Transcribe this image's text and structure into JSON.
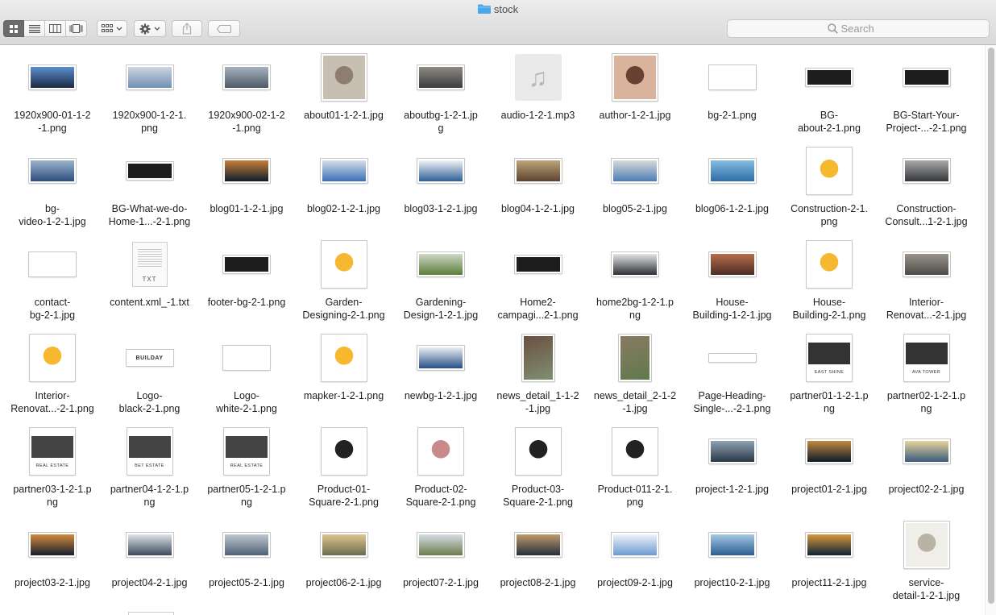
{
  "window": {
    "title": "stock"
  },
  "toolbar": {
    "view_modes": [
      "icon-view",
      "list-view",
      "column-view",
      "cover-flow-view"
    ],
    "search_placeholder": "Search"
  },
  "colors": {
    "toolbar_bg": "#dedede",
    "selected_segment": "#6b6b6b",
    "folder_blue": "#4aa8e8",
    "logo_yellow": "#f5b82e"
  },
  "files": [
    {
      "label": "1920x900-01-1-2\n-1.png",
      "thumb": "wide",
      "colors": [
        "#1b2a44",
        "#5b8fcf"
      ]
    },
    {
      "label": "1920x900-1-2-1.\npng",
      "thumb": "wide",
      "colors": [
        "#6f8fb3",
        "#ccd6df"
      ]
    },
    {
      "label": "1920x900-02-1-2\n-1.png",
      "thumb": "wide",
      "colors": [
        "#4e5967",
        "#a7b2bf"
      ]
    },
    {
      "label": "about01-1-2-1.jpg",
      "thumb": "square",
      "colors": [
        "#c8bfb3",
        "#8d7e70"
      ]
    },
    {
      "label": "aboutbg-1-2-1.jp\ng",
      "thumb": "wide",
      "colors": [
        "#3b3d3f",
        "#8e8a82"
      ]
    },
    {
      "label": "audio-1-2-1.mp3",
      "thumb": "audio"
    },
    {
      "label": "author-1-2-1.jpg",
      "thumb": "square",
      "colors": [
        "#d9b39c",
        "#6a4033"
      ]
    },
    {
      "label": "bg-2-1.png",
      "thumb": "blank"
    },
    {
      "label": "BG-\nabout-2-1.png",
      "thumb": "dark"
    },
    {
      "label": "BG-Start-Your-\nProject-...-2-1.png",
      "thumb": "dark"
    },
    {
      "label": "bg-\nvideo-1-2-1.jpg",
      "thumb": "wide",
      "colors": [
        "#2d4d7c",
        "#9cb3cc"
      ]
    },
    {
      "label": "BG-What-we-do-\nHome-1...-2-1.png",
      "thumb": "dark"
    },
    {
      "label": "blog01-1-2-1.jpg",
      "thumb": "wide",
      "colors": [
        "#0f1c2c",
        "#c77f3a"
      ]
    },
    {
      "label": "blog02-1-2-1.jpg",
      "thumb": "wide",
      "colors": [
        "#3b6fb5",
        "#d4dfe9"
      ]
    },
    {
      "label": "blog03-1-2-1.jpg",
      "thumb": "wide",
      "colors": [
        "#2c5f96",
        "#f0f2f5"
      ]
    },
    {
      "label": "blog04-1-2-1.jpg",
      "thumb": "wide",
      "colors": [
        "#5a4331",
        "#c0a477"
      ]
    },
    {
      "label": "blog05-2-1.jpg",
      "thumb": "wide",
      "colors": [
        "#4b7db4",
        "#d9d9d9"
      ]
    },
    {
      "label": "blog06-1-2-1.jpg",
      "thumb": "wide",
      "colors": [
        "#2e6da8",
        "#84bde0"
      ]
    },
    {
      "label": "Construction-2-1.\npng",
      "thumb": "square",
      "colors": [
        "#ffffff",
        "#f5b82e"
      ]
    },
    {
      "label": "Construction-\nConsult...1-2-1.jpg",
      "thumb": "wide",
      "colors": [
        "#34363a",
        "#a9a9a9"
      ]
    },
    {
      "label": "contact-\nbg-2-1.jpg",
      "thumb": "blank"
    },
    {
      "label": "content.xml_-1.txt",
      "thumb": "doc",
      "doc_text": "TXT"
    },
    {
      "label": "footer-bg-2-1.png",
      "thumb": "dark"
    },
    {
      "label": "Garden-\nDesigning-2-1.png",
      "thumb": "square",
      "colors": [
        "#ffffff",
        "#f5b82e"
      ]
    },
    {
      "label": "Gardening-\nDesign-1-2-1.jpg",
      "thumb": "wide",
      "colors": [
        "#5b7d3a",
        "#cfd8c8"
      ]
    },
    {
      "label": "Home2-\ncampagi...2-1.png",
      "thumb": "dark"
    },
    {
      "label": "home2bg-1-2-1.p\nng",
      "thumb": "wide",
      "colors": [
        "#2b2f36",
        "#e5e5e5"
      ]
    },
    {
      "label": "House-\nBuilding-1-2-1.jpg",
      "thumb": "wide",
      "colors": [
        "#4b2c25",
        "#b66e4a"
      ]
    },
    {
      "label": "House-\nBuilding-2-1.png",
      "thumb": "square",
      "colors": [
        "#ffffff",
        "#f5b82e"
      ]
    },
    {
      "label": "Interior-\nRenovat...-2-1.jpg",
      "thumb": "wide",
      "colors": [
        "#4b4a48",
        "#9b9489"
      ]
    },
    {
      "label": "Interior-\nRenovat...-2-1.png",
      "thumb": "square",
      "colors": [
        "#ffffff",
        "#f5b82e"
      ]
    },
    {
      "label": "Logo-\nblack-2-1.png",
      "thumb": "logo",
      "logo_text": "BUILDAY"
    },
    {
      "label": "Logo-\nwhite-2-1.png",
      "thumb": "blank"
    },
    {
      "label": "mapker-1-2-1.png",
      "thumb": "square",
      "colors": [
        "#ffffff",
        "#f5b82e"
      ]
    },
    {
      "label": "newbg-1-2-1.jpg",
      "thumb": "wide",
      "colors": [
        "#264f86",
        "#e9eef3"
      ]
    },
    {
      "label": "news_detail_1-1-2\n-1.jpg",
      "thumb": "tall",
      "colors": [
        "#6b5042",
        "#7f8f72"
      ]
    },
    {
      "label": "news_detail_2-1-2\n-1.jpg",
      "thumb": "tall",
      "colors": [
        "#8a7a62",
        "#5e7a4c"
      ]
    },
    {
      "label": "Page-Heading-\nSingle-...-2-1.png",
      "thumb": "strip"
    },
    {
      "label": "partner01-1-2-1.p\nng",
      "thumb": "square",
      "colors": [
        "#ffffff",
        "#333333"
      ],
      "logo_text": "EAST SHINE"
    },
    {
      "label": "partner02-1-2-1.p\nng",
      "thumb": "square",
      "colors": [
        "#ffffff",
        "#333333"
      ],
      "logo_text": "AVA TOWER"
    },
    {
      "label": "partner03-1-2-1.p\nng",
      "thumb": "square",
      "colors": [
        "#ffffff",
        "#444444"
      ],
      "logo_text": "REAL ESTATE"
    },
    {
      "label": "partner04-1-2-1.p\nng",
      "thumb": "square",
      "colors": [
        "#ffffff",
        "#444444"
      ],
      "logo_text": "BET ESTATE"
    },
    {
      "label": "partner05-1-2-1.p\nng",
      "thumb": "square",
      "colors": [
        "#ffffff",
        "#444444"
      ],
      "logo_text": "REAL ESTATE"
    },
    {
      "label": "Product-01-\nSquare-2-1.png",
      "thumb": "square",
      "colors": [
        "#ffffff",
        "#222222"
      ]
    },
    {
      "label": "Product-02-\nSquare-2-1.png",
      "thumb": "square",
      "colors": [
        "#ffffff",
        "#c98a8a"
      ]
    },
    {
      "label": "Product-03-\nSquare-2-1.png",
      "thumb": "square",
      "colors": [
        "#ffffff",
        "#222222"
      ]
    },
    {
      "label": "Product-011-2-1.\npng",
      "thumb": "square",
      "colors": [
        "#ffffff",
        "#222222"
      ]
    },
    {
      "label": "project-1-2-1.jpg",
      "thumb": "wide",
      "colors": [
        "#2a3746",
        "#8ea3b5"
      ]
    },
    {
      "label": "project01-2-1.jpg",
      "thumb": "wide",
      "colors": [
        "#0d1a2b",
        "#c28a3e"
      ]
    },
    {
      "label": "project02-2-1.jpg",
      "thumb": "wide",
      "colors": [
        "#3a5a7e",
        "#e8d49b"
      ]
    },
    {
      "label": "project03-2-1.jpg",
      "thumb": "wide",
      "colors": [
        "#16202f",
        "#d38b3f"
      ]
    },
    {
      "label": "project04-2-1.jpg",
      "thumb": "wide",
      "colors": [
        "#3d4b5e",
        "#dde3e8"
      ]
    },
    {
      "label": "project05-2-1.jpg",
      "thumb": "wide",
      "colors": [
        "#4d6076",
        "#bfc7cf"
      ]
    },
    {
      "label": "project06-2-1.jpg",
      "thumb": "wide",
      "colors": [
        "#6a6d50",
        "#e0c48e"
      ]
    },
    {
      "label": "project07-2-1.jpg",
      "thumb": "wide",
      "colors": [
        "#6a7d4c",
        "#d7dde3"
      ]
    },
    {
      "label": "project08-2-1.jpg",
      "thumb": "wide",
      "colors": [
        "#252f3d",
        "#c09a6b"
      ]
    },
    {
      "label": "project09-2-1.jpg",
      "thumb": "wide",
      "colors": [
        "#6b9bd0",
        "#eef3f8"
      ]
    },
    {
      "label": "project10-2-1.jpg",
      "thumb": "wide",
      "colors": [
        "#2c5d90",
        "#a5c8e4"
      ]
    },
    {
      "label": "project11-2-1.jpg",
      "thumb": "wide",
      "colors": [
        "#0d2236",
        "#d79a3b"
      ]
    },
    {
      "label": "service-\ndetail-1-2-1.jpg",
      "thumb": "square",
      "colors": [
        "#f0eee9",
        "#b9b2a6"
      ]
    }
  ]
}
